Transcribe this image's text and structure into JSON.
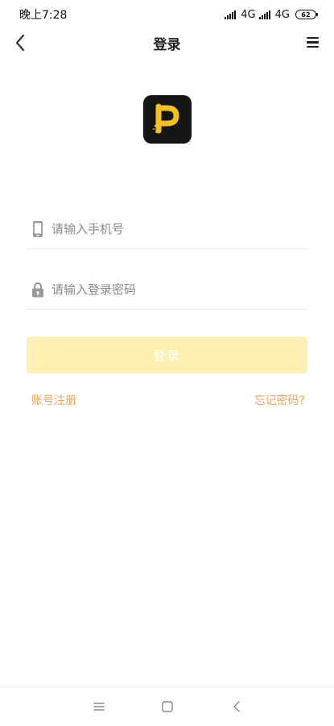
{
  "status_bar": {
    "time": "晚上7:28",
    "network_1": "4G",
    "network_2": "4G",
    "battery": "62"
  },
  "nav": {
    "title": "登录",
    "back_icon": "chevron-left-icon",
    "menu_icon": "hamburger-menu-icon"
  },
  "logo": {
    "icon": "app-logo-p",
    "accent_color": "#f5c21b",
    "background_color": "#151515"
  },
  "form": {
    "phone_placeholder": "请输入手机号",
    "phone_value": "",
    "password_placeholder": "请输入登录密码",
    "password_value": "",
    "login_label": "登录",
    "login_button_color": "#fdf0b2"
  },
  "links": {
    "register": "账号注册",
    "forgot_password": "忘记密码?",
    "link_color": "#f0a35a"
  },
  "system_nav": {
    "menu_icon": "recent-apps-icon",
    "home_icon": "home-icon",
    "back_icon": "back-icon"
  }
}
